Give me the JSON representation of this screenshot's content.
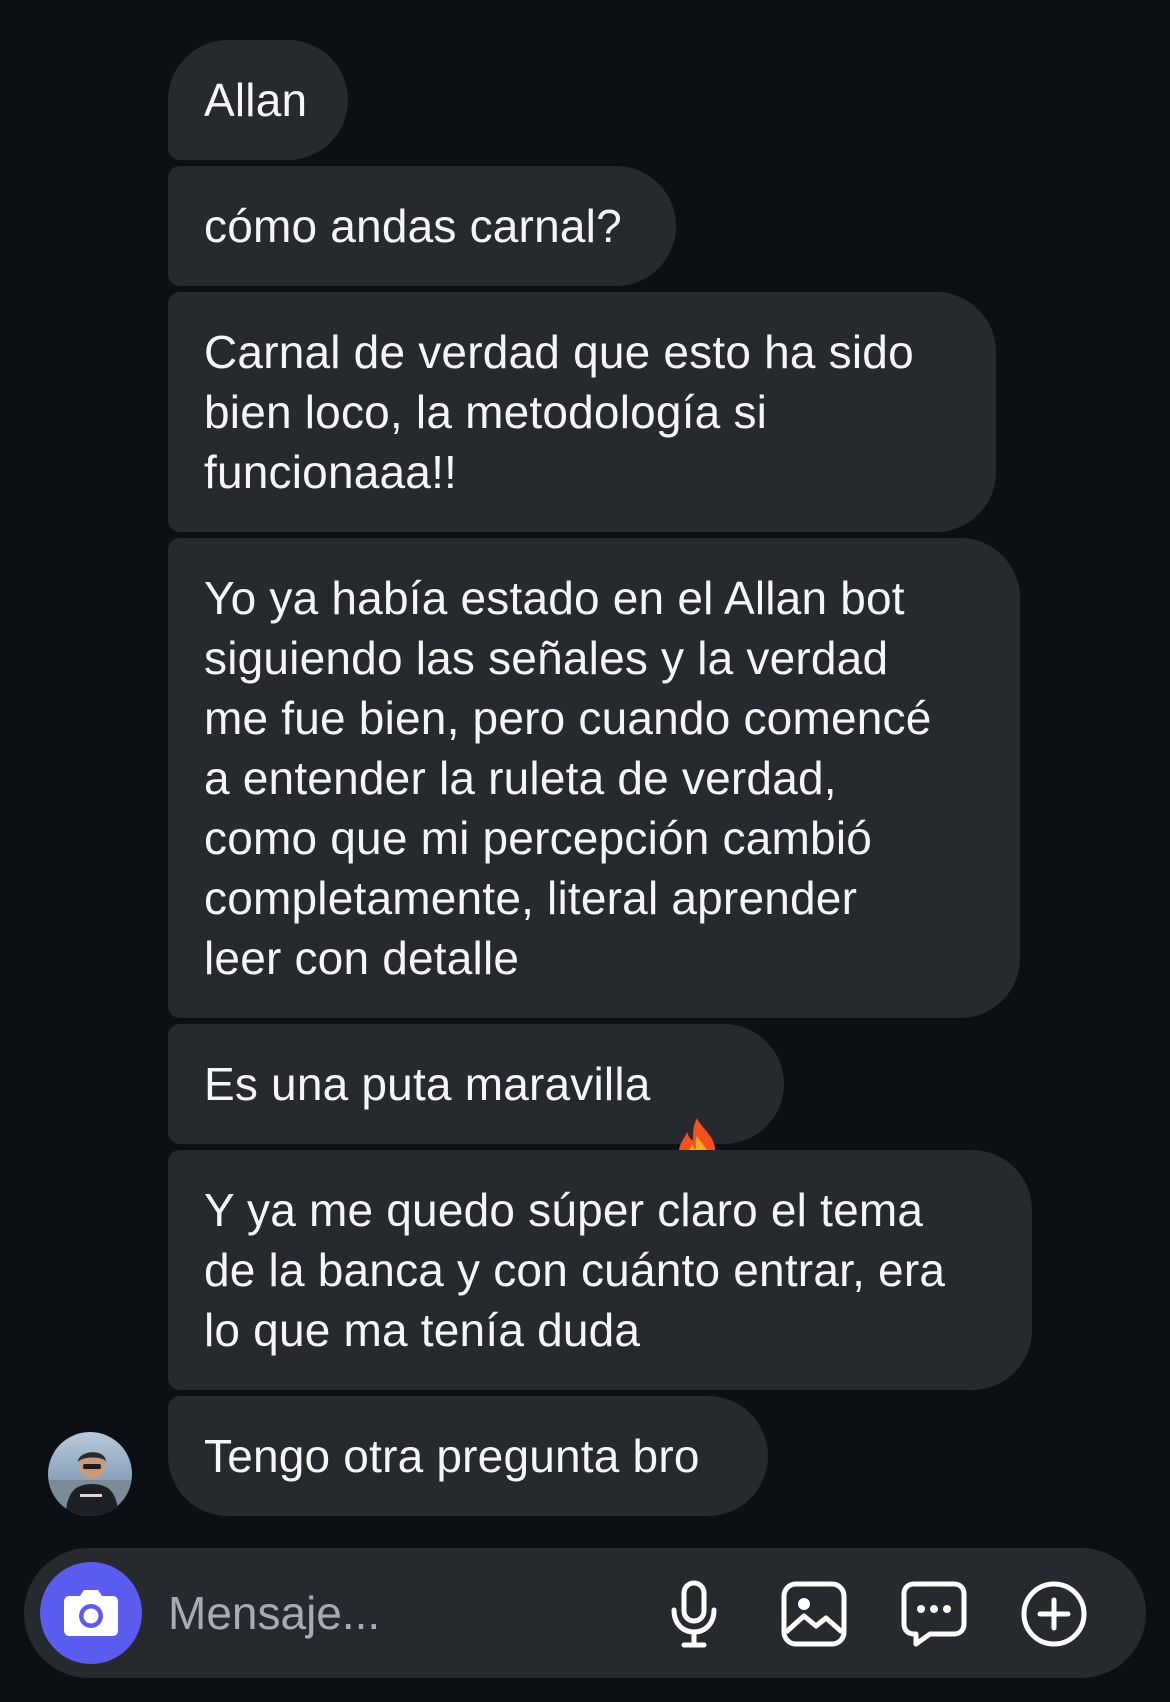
{
  "messages": [
    {
      "text": "Allan"
    },
    {
      "text": "cómo andas carnal?"
    },
    {
      "text": "Carnal de verdad que esto ha sido\nbien loco, la metodología si\nfuncionaaa!!"
    },
    {
      "text": "Yo ya había estado en el Allan bot\nsiguiendo las señales y la verdad\nme fue bien, pero cuando comencé\na entender la ruleta de verdad,\ncomo que mi percepción cambió\ncompletamente, literal aprender\nleer con detalle"
    },
    {
      "text": "Es una puta maravilla",
      "emoji": "fire-icon"
    },
    {
      "text": "Y ya me quedo súper claro el tema\nde la banca y con cuánto entrar, era\nlo que ma tenía duda"
    },
    {
      "text": "Tengo otra pregunta bro"
    }
  ],
  "composer": {
    "placeholder": "Mensaje...",
    "value": "",
    "icons": [
      "camera-icon",
      "microphone-icon",
      "gallery-icon",
      "sticker-icon",
      "plus-circle-icon"
    ]
  },
  "colors": {
    "background": "#0c1014",
    "bubble": "#262a2f",
    "camera_button": "#5b5bf0",
    "placeholder": "#a8acb2"
  }
}
